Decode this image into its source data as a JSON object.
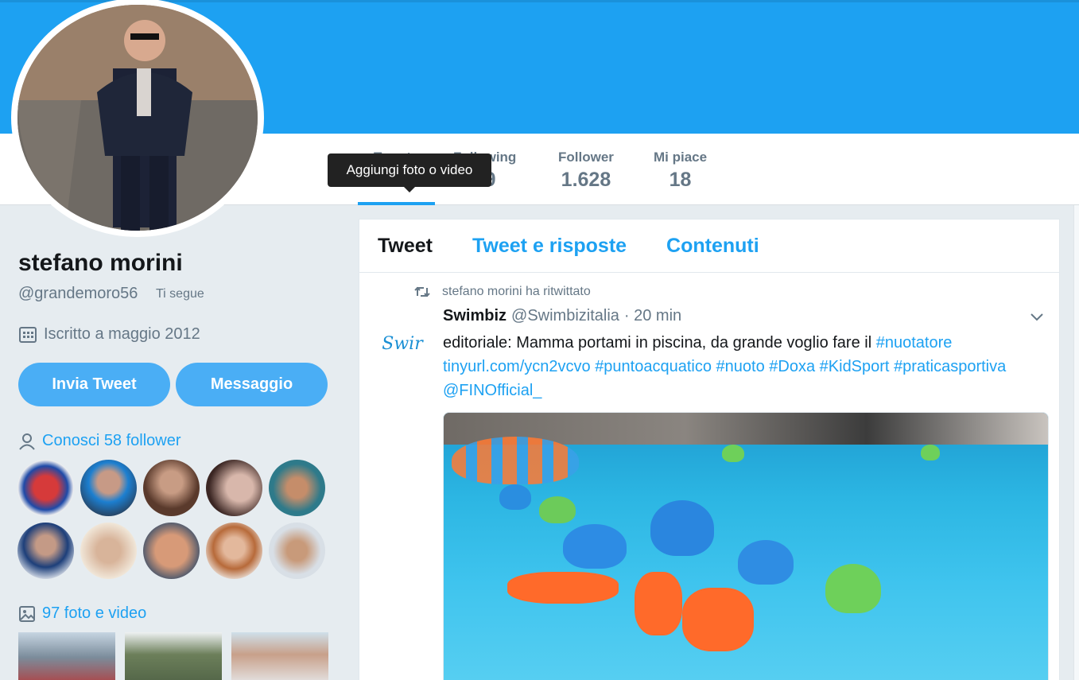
{
  "profile": {
    "name": "stefano morini",
    "handle": "@grandemoro56",
    "follows_you": "Ti segue",
    "joined": "Iscritto a maggio 2012"
  },
  "stats": [
    {
      "label": "Tweet",
      "value": ""
    },
    {
      "label": "Following",
      "value": "99"
    },
    {
      "label": "Follower",
      "value": "1.628"
    },
    {
      "label": "Mi piace",
      "value": "18"
    }
  ],
  "tooltip": "Aggiungi foto o video",
  "buttons": {
    "tweet": "Invia Tweet",
    "message": "Messaggio"
  },
  "known_followers": "Conosci 58 follower",
  "photos": "97 foto e video",
  "tabs": [
    "Tweet",
    "Tweet e risposte",
    "Contenuti"
  ],
  "tweet": {
    "retweeted_by": "stefano morini ha ritwittato",
    "author": "Swimbiz",
    "author_handle": "@Swimbizitalia",
    "time": "· 20 min",
    "avatar_text": "Swir",
    "text_plain": "editoriale: Mamma portami in piscina, da grande voglio fare il",
    "links": [
      "#nuotatore",
      "tinyurl.com/ycn2vcvo",
      "#puntoacquatico",
      "#nuoto",
      "#Doxa",
      "#KidSport",
      "#praticasportiva",
      "@FINOfficial_"
    ]
  },
  "colors": {
    "accent": "#1da1f2",
    "banner": "#1da1f2",
    "button": "#4aaef5",
    "muted": "#657786"
  },
  "icons": [
    "calendar-icon",
    "person-icon",
    "image-icon",
    "retweet-icon",
    "chevron-down-icon"
  ]
}
